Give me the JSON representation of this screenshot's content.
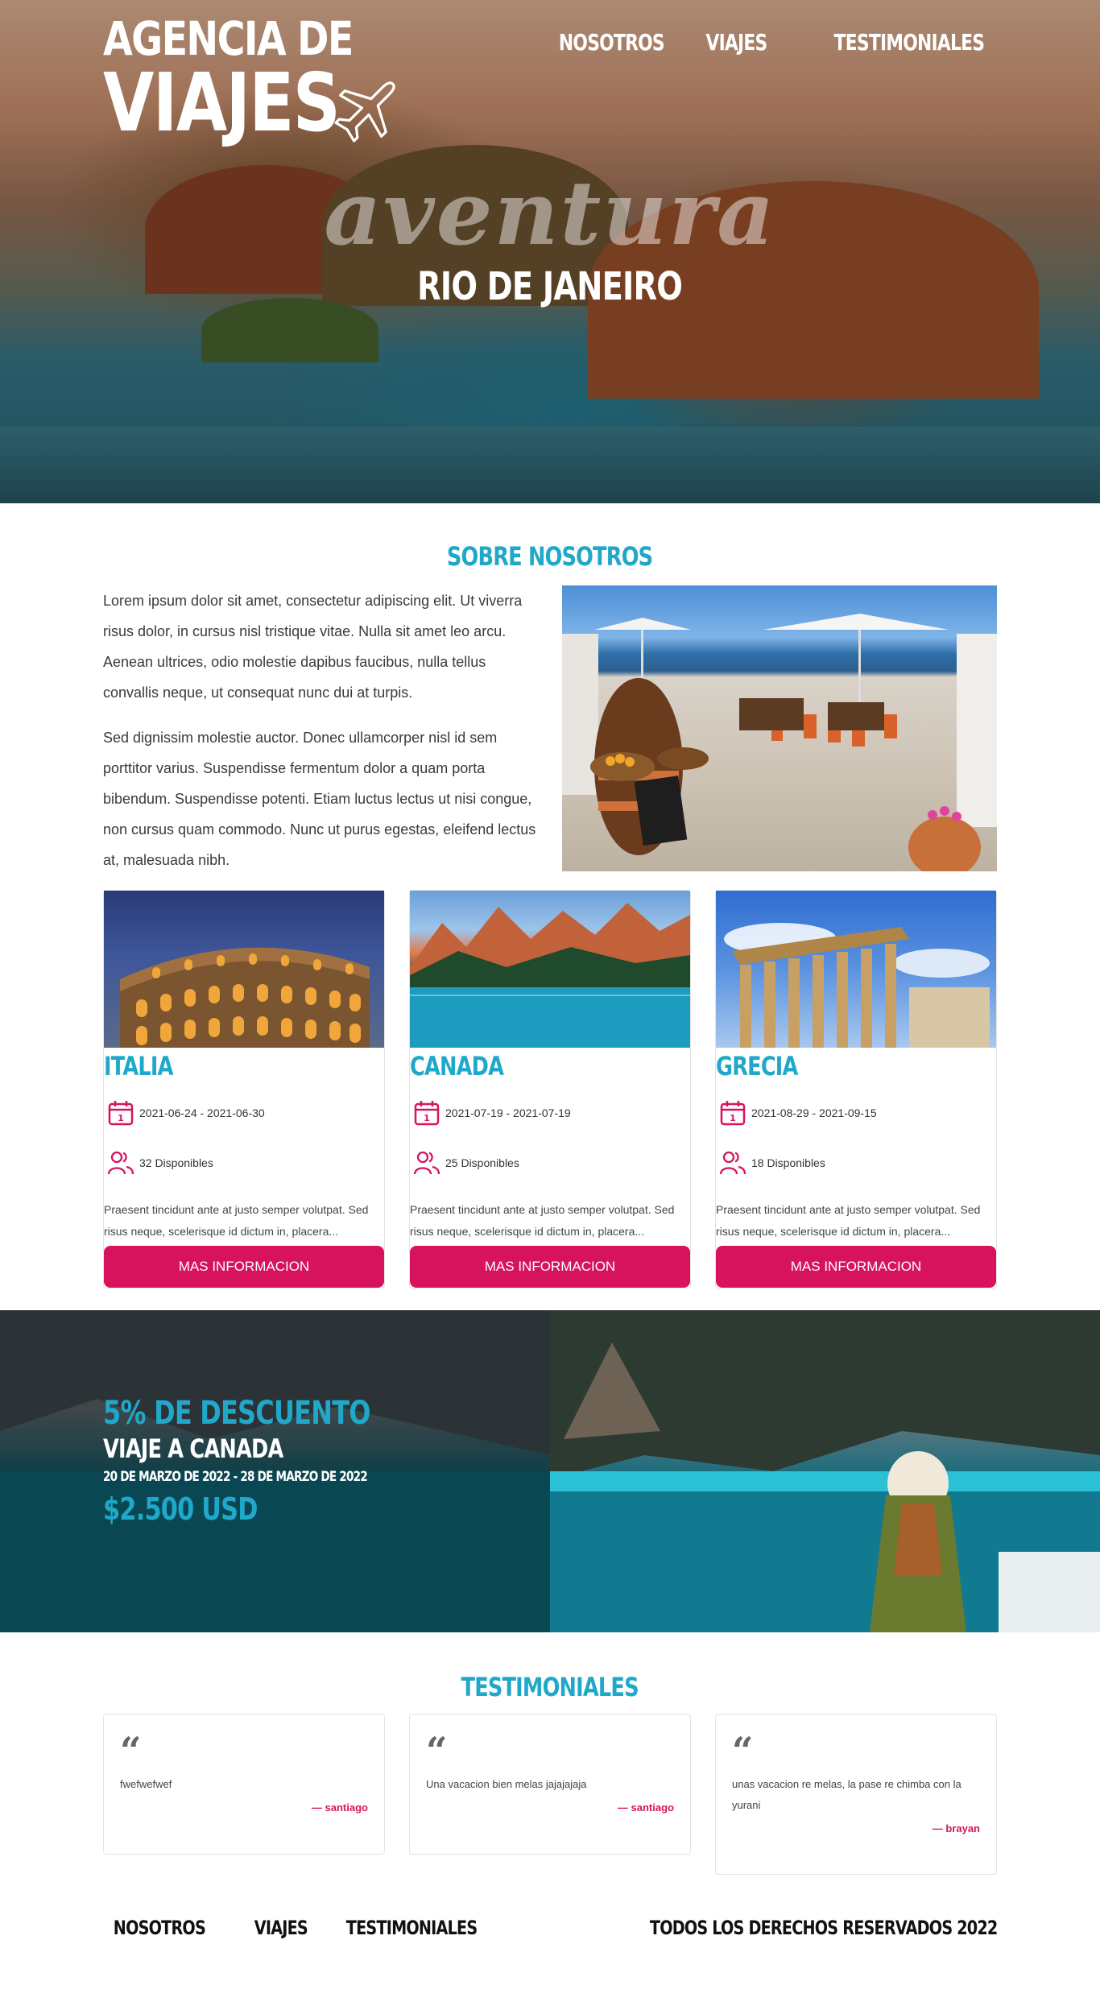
{
  "header": {
    "logo_line1": "AGENCIA DE",
    "logo_line2": "VIAJES",
    "logo_icon": "airplane-icon",
    "nav": [
      {
        "label": "NOSOTROS"
      },
      {
        "label": "VIAJES"
      },
      {
        "label": "TESTIMONIALES"
      }
    ]
  },
  "hero": {
    "script_text": "aventura",
    "destination": "RIO DE JANEIRO"
  },
  "about": {
    "title": "SOBRE NOSOTROS",
    "paragraph1": "Lorem ipsum dolor sit amet, consectetur adipiscing elit. Ut viverra risus dolor, in cursus nisl tristique vitae. Nulla sit amet leo arcu. Aenean ultrices, odio molestie dapibus faucibus, nulla tellus convallis neque, ut consequat nunc dui at turpis.",
    "paragraph2": "Sed dignissim molestie auctor. Donec ullamcorper nisl id sem porttitor varius. Suspendisse fermentum dolor a quam porta bibendum. Suspendisse potenti. Etiam luctus lectus ut nisi congue, non cursus quam commodo. Nunc ut purus egestas, eleifend lectus at, malesuada nibh."
  },
  "trips": [
    {
      "name": "ITALIA",
      "dates": "2021-06-24 - 2021-06-30",
      "available": "32 Disponibles",
      "description": "Praesent tincidunt ante at justo semper volutpat. Sed risus neque, scelerisque id dictum in, placera...",
      "button": "MAS INFORMACION"
    },
    {
      "name": "CANADA",
      "dates": "2021-07-19 - 2021-07-19",
      "available": "25 Disponibles",
      "description": "Praesent tincidunt ante at justo semper volutpat. Sed risus neque, scelerisque id dictum in, placera...",
      "button": "MAS INFORMACION"
    },
    {
      "name": "GRECIA",
      "dates": "2021-08-29 - 2021-09-15",
      "available": "18 Disponibles",
      "description": "Praesent tincidunt ante at justo semper volutpat. Sed risus neque, scelerisque id dictum in, placera...",
      "button": "MAS INFORMACION"
    }
  ],
  "promo": {
    "discount": "5% DE DESCUENTO",
    "trip": "VIAJE A CANADA",
    "dates": "20 DE MARZO DE 2022 - 28 DE MARZO DE 2022",
    "price": "$2.500 USD"
  },
  "testimonials": {
    "title": "TESTIMONIALES",
    "items": [
      {
        "message": "fwefwefwef",
        "author": "— santiago"
      },
      {
        "message": "Una vacacion bien melas jajajajaja",
        "author": "— santiago"
      },
      {
        "message": "unas vacacion re melas, la pase re chimba con la yurani",
        "author": "— brayan"
      }
    ]
  },
  "footer": {
    "nav": [
      {
        "label": "NOSOTROS"
      },
      {
        "label": "VIAJES"
      },
      {
        "label": "TESTIMONIALES"
      }
    ],
    "rights": "TODOS LOS DERECHOS RESERVADOS 2022"
  },
  "colors": {
    "accent": "#1fa8c9",
    "brand": "#d7135e"
  }
}
